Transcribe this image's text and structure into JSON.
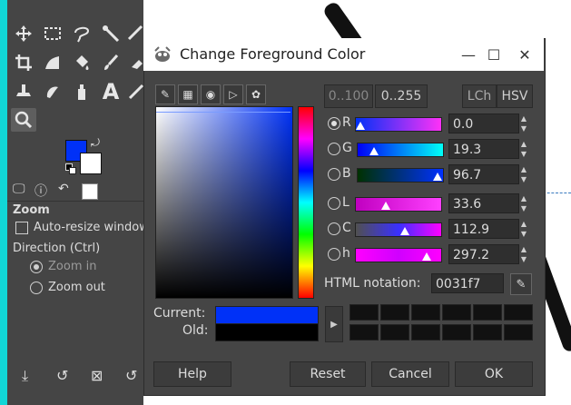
{
  "toolbox": {
    "tool_options_title": "Zoom",
    "auto_resize_label": "Auto-resize window",
    "direction_label": "Direction  (Ctrl)",
    "zoom_in_label": "Zoom in",
    "zoom_out_label": "Zoom out",
    "foreground_color": "#0031f7",
    "background_color": "#ffffff",
    "text_tool_glyph": "A"
  },
  "dialog": {
    "title": "Change Foreground Color",
    "range_buttons": [
      "0..100",
      "0..255"
    ],
    "mode_buttons": [
      "LCh",
      "HSV"
    ],
    "channels": [
      {
        "key": "R",
        "value": "0.0",
        "selected": true
      },
      {
        "key": "G",
        "value": "19.3",
        "selected": false
      },
      {
        "key": "B",
        "value": "96.7",
        "selected": false
      },
      {
        "key": "L",
        "value": "33.6",
        "selected": false
      },
      {
        "key": "C",
        "value": "112.9",
        "selected": false
      },
      {
        "key": "h",
        "value": "297.2",
        "selected": false
      }
    ],
    "html_notation_label": "HTML notation:",
    "html_notation_value": "0031f7",
    "current_label": "Current:",
    "old_label": "Old:",
    "current_color": "#0031f7",
    "old_color": "#000000",
    "buttons": {
      "help": "Help",
      "reset": "Reset",
      "cancel": "Cancel",
      "ok": "OK"
    }
  }
}
